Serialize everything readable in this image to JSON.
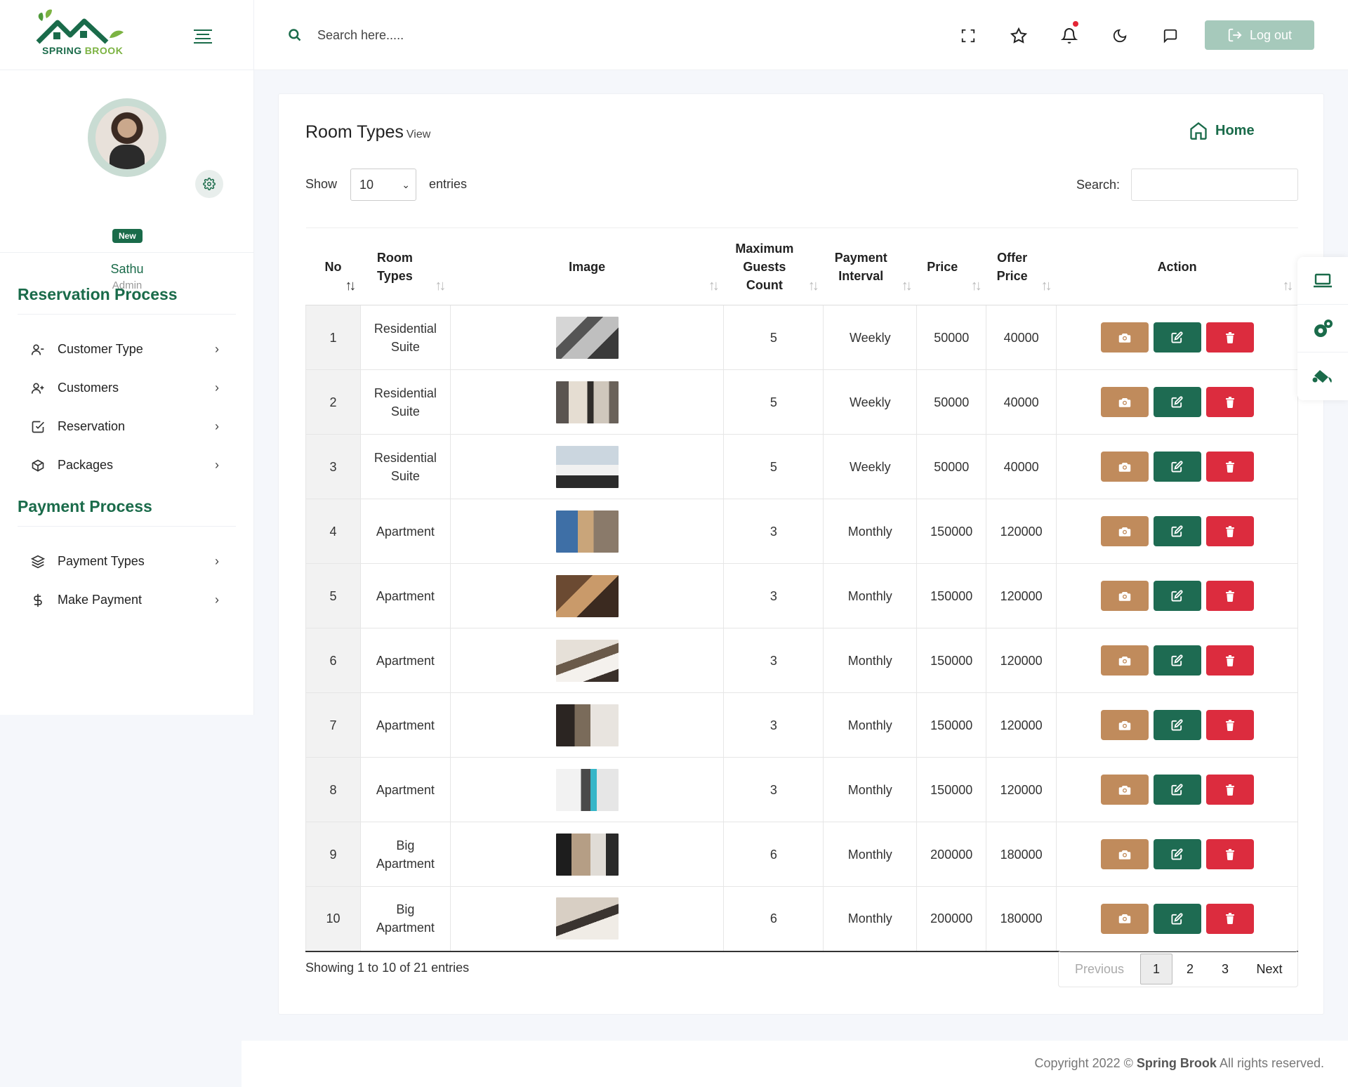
{
  "app": {
    "logo_word1": "SPRING",
    "logo_word2": "BROOK"
  },
  "profile": {
    "name": "Sathu",
    "role": "Admin",
    "badge": "New"
  },
  "sidebar": {
    "sections": [
      {
        "title": "Reservation Process",
        "items": [
          {
            "label": "Customer Type",
            "icon": "user-minus-icon"
          },
          {
            "label": "Customers",
            "icon": "user-plus-icon"
          },
          {
            "label": "Reservation",
            "icon": "check-square-icon"
          },
          {
            "label": "Packages",
            "icon": "package-icon"
          }
        ]
      },
      {
        "title": "Payment Process",
        "items": [
          {
            "label": "Payment Types",
            "icon": "layers-icon"
          },
          {
            "label": "Make Payment",
            "icon": "dollar-icon"
          }
        ]
      }
    ],
    "chevron": "›"
  },
  "header": {
    "search_placeholder": "Search here.....",
    "logout_label": "Log out"
  },
  "page": {
    "title": "Room Types",
    "subtitle": "View",
    "home_label": "Home"
  },
  "table_controls": {
    "show_label": "Show",
    "entries_value": "10",
    "entries_label": "entries",
    "search_label": "Search:"
  },
  "table": {
    "columns": [
      {
        "label": "No"
      },
      {
        "label": "Room Types"
      },
      {
        "label": "Image"
      },
      {
        "label": "Maximum Guests Count"
      },
      {
        "label": "Payment Interval"
      },
      {
        "label": "Price"
      },
      {
        "label": "Offer Price"
      },
      {
        "label": "Action"
      }
    ],
    "rows": [
      {
        "no": "1",
        "room_type": "Residential Suite",
        "guests": "5",
        "interval": "Weekly",
        "price": "50000",
        "offer": "40000"
      },
      {
        "no": "2",
        "room_type": "Residential Suite",
        "guests": "5",
        "interval": "Weekly",
        "price": "50000",
        "offer": "40000"
      },
      {
        "no": "3",
        "room_type": "Residential Suite",
        "guests": "5",
        "interval": "Weekly",
        "price": "50000",
        "offer": "40000"
      },
      {
        "no": "4",
        "room_type": "Apartment",
        "guests": "3",
        "interval": "Monthly",
        "price": "150000",
        "offer": "120000"
      },
      {
        "no": "5",
        "room_type": "Apartment",
        "guests": "3",
        "interval": "Monthly",
        "price": "150000",
        "offer": "120000"
      },
      {
        "no": "6",
        "room_type": "Apartment",
        "guests": "3",
        "interval": "Monthly",
        "price": "150000",
        "offer": "120000"
      },
      {
        "no": "7",
        "room_type": "Apartment",
        "guests": "3",
        "interval": "Monthly",
        "price": "150000",
        "offer": "120000"
      },
      {
        "no": "8",
        "room_type": "Apartment",
        "guests": "3",
        "interval": "Monthly",
        "price": "150000",
        "offer": "120000"
      },
      {
        "no": "9",
        "room_type": "Big Apartment",
        "guests": "6",
        "interval": "Monthly",
        "price": "200000",
        "offer": "180000"
      },
      {
        "no": "10",
        "room_type": "Big Apartment",
        "guests": "6",
        "interval": "Monthly",
        "price": "200000",
        "offer": "180000"
      }
    ]
  },
  "footer_table": {
    "showing_text": "Showing 1 to 10 of 21 entries",
    "previous": "Previous",
    "pages": [
      "1",
      "2",
      "3"
    ],
    "next": "Next"
  },
  "footer": {
    "prefix": "Copyright 2022 ©",
    "brand": "Spring Brook",
    "suffix": "All rights reserved."
  },
  "colors": {
    "primary": "#1a6b4a",
    "camera_button": "#c08b5c",
    "edit_button": "#1e6b52",
    "delete_button": "#dc2c3e",
    "logout_button": "#a6c9bb"
  }
}
